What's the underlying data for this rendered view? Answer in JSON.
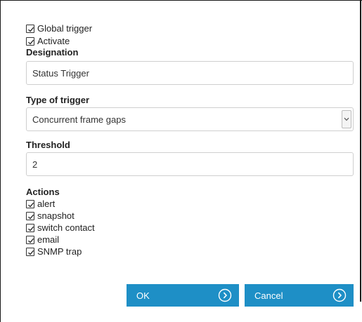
{
  "general": {
    "global_trigger": {
      "label": "Global trigger",
      "checked": true
    },
    "activate": {
      "label": "Activate",
      "checked": true
    }
  },
  "designation": {
    "label": "Designation",
    "value": "Status Trigger"
  },
  "trigger_type": {
    "label": "Type of trigger",
    "selected": "Concurrent frame gaps",
    "icon": "chevron-down-icon"
  },
  "threshold": {
    "label": "Threshold",
    "value": "2"
  },
  "actions": {
    "label": "Actions",
    "items": [
      {
        "label": "alert",
        "checked": true
      },
      {
        "label": "snapshot",
        "checked": true
      },
      {
        "label": "switch contact",
        "checked": true
      },
      {
        "label": "email",
        "checked": true
      },
      {
        "label": "SNMP trap",
        "checked": true
      }
    ]
  },
  "buttons": {
    "ok_label": "OK",
    "cancel_label": "Cancel",
    "icon": "circle-chevron-right-icon",
    "color": "#1e8fc6"
  }
}
